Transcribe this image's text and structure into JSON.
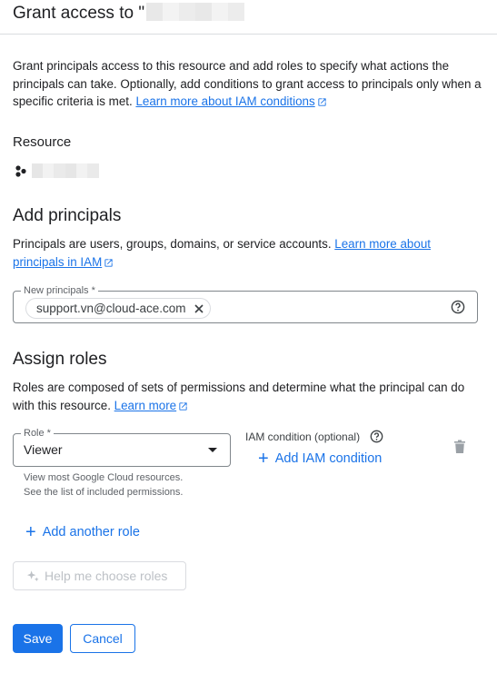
{
  "header": {
    "title": "Grant access to \""
  },
  "intro": {
    "text": "Grant principals access to this resource and add roles to specify what actions the principals can take. Optionally, add conditions to grant access to principals only when a specific criteria is met.",
    "link": "Learn more about IAM conditions"
  },
  "resource": {
    "heading": "Resource",
    "icon": "resource-dots-icon"
  },
  "principals": {
    "heading": "Add principals",
    "description": "Principals are users, groups, domains, or service accounts.",
    "link": "Learn more about principals in IAM",
    "field_label": "New principals *",
    "chips": [
      "support.vn@cloud-ace.com"
    ]
  },
  "roles": {
    "heading": "Assign roles",
    "description": "Roles are composed of sets of permissions and determine what the principal can do with this resource.",
    "link": "Learn more",
    "role_label": "Role *",
    "role_value": "Viewer",
    "role_hint_1": "View most Google Cloud resources.",
    "role_hint_2": "See the list of included permissions.",
    "condition_label": "IAM condition (optional)",
    "add_condition": "Add IAM condition",
    "add_another_role": "Add another role",
    "help_choose": "Help me choose roles"
  },
  "actions": {
    "save": "Save",
    "cancel": "Cancel"
  },
  "colors": {
    "accent": "#1a73e8",
    "border": "#dadce0",
    "text": "#202124",
    "muted": "#5f6368"
  }
}
